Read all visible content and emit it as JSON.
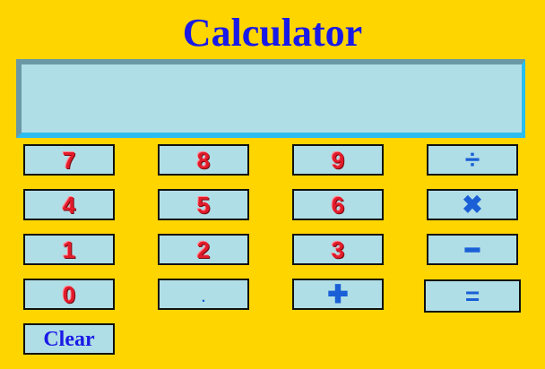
{
  "app": {
    "title": "Calculator"
  },
  "display": {
    "value": ""
  },
  "keys": {
    "seven": "7",
    "eight": "8",
    "nine": "9",
    "divide": "÷",
    "four": "4",
    "five": "5",
    "six": "6",
    "multiply": "✖",
    "one": "1",
    "two": "2",
    "three": "3",
    "subtract": "━",
    "zero": "0",
    "decimal": ".",
    "add": "✚",
    "equals": "=",
    "clear": "Clear"
  },
  "colors": {
    "background": "#FFD500",
    "display": "#B0DEE6",
    "key": "#B0DEE6",
    "digit": "#E21B2B",
    "operator": "#1A5FD6",
    "title": "#1A1AE6"
  }
}
